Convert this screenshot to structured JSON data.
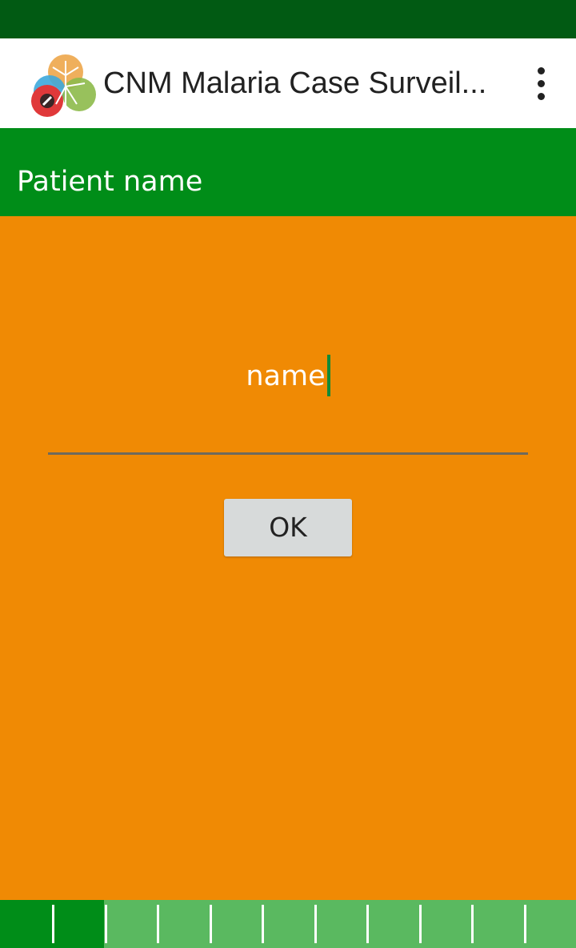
{
  "app_bar": {
    "title": "CNM Malaria Case Surveil...",
    "logo_icon": "malaria-mosquito-logo-icon",
    "menu_icon": "more-vert-icon"
  },
  "section": {
    "title": "Patient name"
  },
  "form": {
    "name_value": "name",
    "ok_label": "OK"
  },
  "progress": {
    "completed_fraction": 0.18,
    "segments": 11
  },
  "colors": {
    "status_bar": "#015A13",
    "header_green": "#008D18",
    "content_orange": "#F08A04",
    "progress_pending": "#5AB960",
    "cursor_green": "#138A38",
    "button_gray": "#D7DADA"
  }
}
